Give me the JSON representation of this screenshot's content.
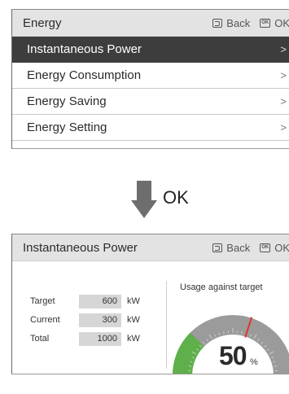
{
  "top_screen": {
    "title": "Energy",
    "back_label": "Back",
    "ok_label": "OK",
    "ok_key_text": "OK",
    "menu": [
      {
        "label": "Instantaneous Power",
        "chevron": ">",
        "selected": true
      },
      {
        "label": "Energy Consumption",
        "chevron": ">",
        "selected": false
      },
      {
        "label": "Energy Saving",
        "chevron": ">",
        "selected": false
      },
      {
        "label": "Energy Setting",
        "chevron": ">",
        "selected": false
      }
    ]
  },
  "transition": {
    "ok_text": "OK"
  },
  "bottom_screen": {
    "title": "Instantaneous Power",
    "back_label": "Back",
    "ok_label": "OK",
    "ok_key_text": "OK",
    "stats": [
      {
        "label": "Target",
        "value": "600",
        "unit": "kW"
      },
      {
        "label": "Current",
        "value": "300",
        "unit": "kW"
      },
      {
        "label": "Total",
        "value": "1000",
        "unit": "kW"
      }
    ],
    "gauge": {
      "title": "Usage against target",
      "percent_text": "50",
      "percent_sign": "%",
      "usage_fraction": 0.5,
      "target_marker_fraction": 0.6,
      "fill_color": "#5fb04a",
      "track_color": "#9b9b9b",
      "marker_color": "#e0332c"
    }
  }
}
